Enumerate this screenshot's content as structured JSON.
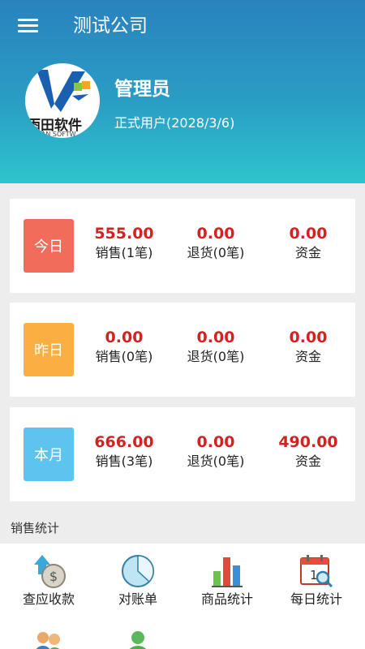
{
  "header": {
    "company": "测试公司",
    "avatar_logo_text": "雨田软件",
    "avatar_logo_sub": "UHAN SOFTW",
    "user_name": "管理员",
    "user_status": "正式用户(2028/3/6)"
  },
  "cards": [
    {
      "period": "今日",
      "color": "#f16c5b",
      "stats": [
        {
          "value": "555.00",
          "label": "销售(1笔)"
        },
        {
          "value": "0.00",
          "label": "退货(0笔)"
        },
        {
          "value": "0.00",
          "label": "资金"
        }
      ]
    },
    {
      "period": "昨日",
      "color": "#fbae42",
      "stats": [
        {
          "value": "0.00",
          "label": "销售(0笔)"
        },
        {
          "value": "0.00",
          "label": "退货(0笔)"
        },
        {
          "value": "0.00",
          "label": "资金"
        }
      ]
    },
    {
      "period": "本月",
      "color": "#5ec4ef",
      "stats": [
        {
          "value": "666.00",
          "label": "销售(3笔)"
        },
        {
          "value": "0.00",
          "label": "退货(0笔)"
        },
        {
          "value": "490.00",
          "label": "资金"
        }
      ]
    }
  ],
  "sales_section": {
    "title": "销售统计",
    "tools": [
      {
        "label": "查应收款",
        "icon": "receivable-icon"
      },
      {
        "label": "对账单",
        "icon": "statement-pie-icon"
      },
      {
        "label": "商品统计",
        "icon": "bar-chart-icon"
      },
      {
        "label": "每日统计",
        "icon": "calendar-search-icon"
      }
    ],
    "more_icons": [
      "customers-icon",
      "employee-icon"
    ]
  }
}
